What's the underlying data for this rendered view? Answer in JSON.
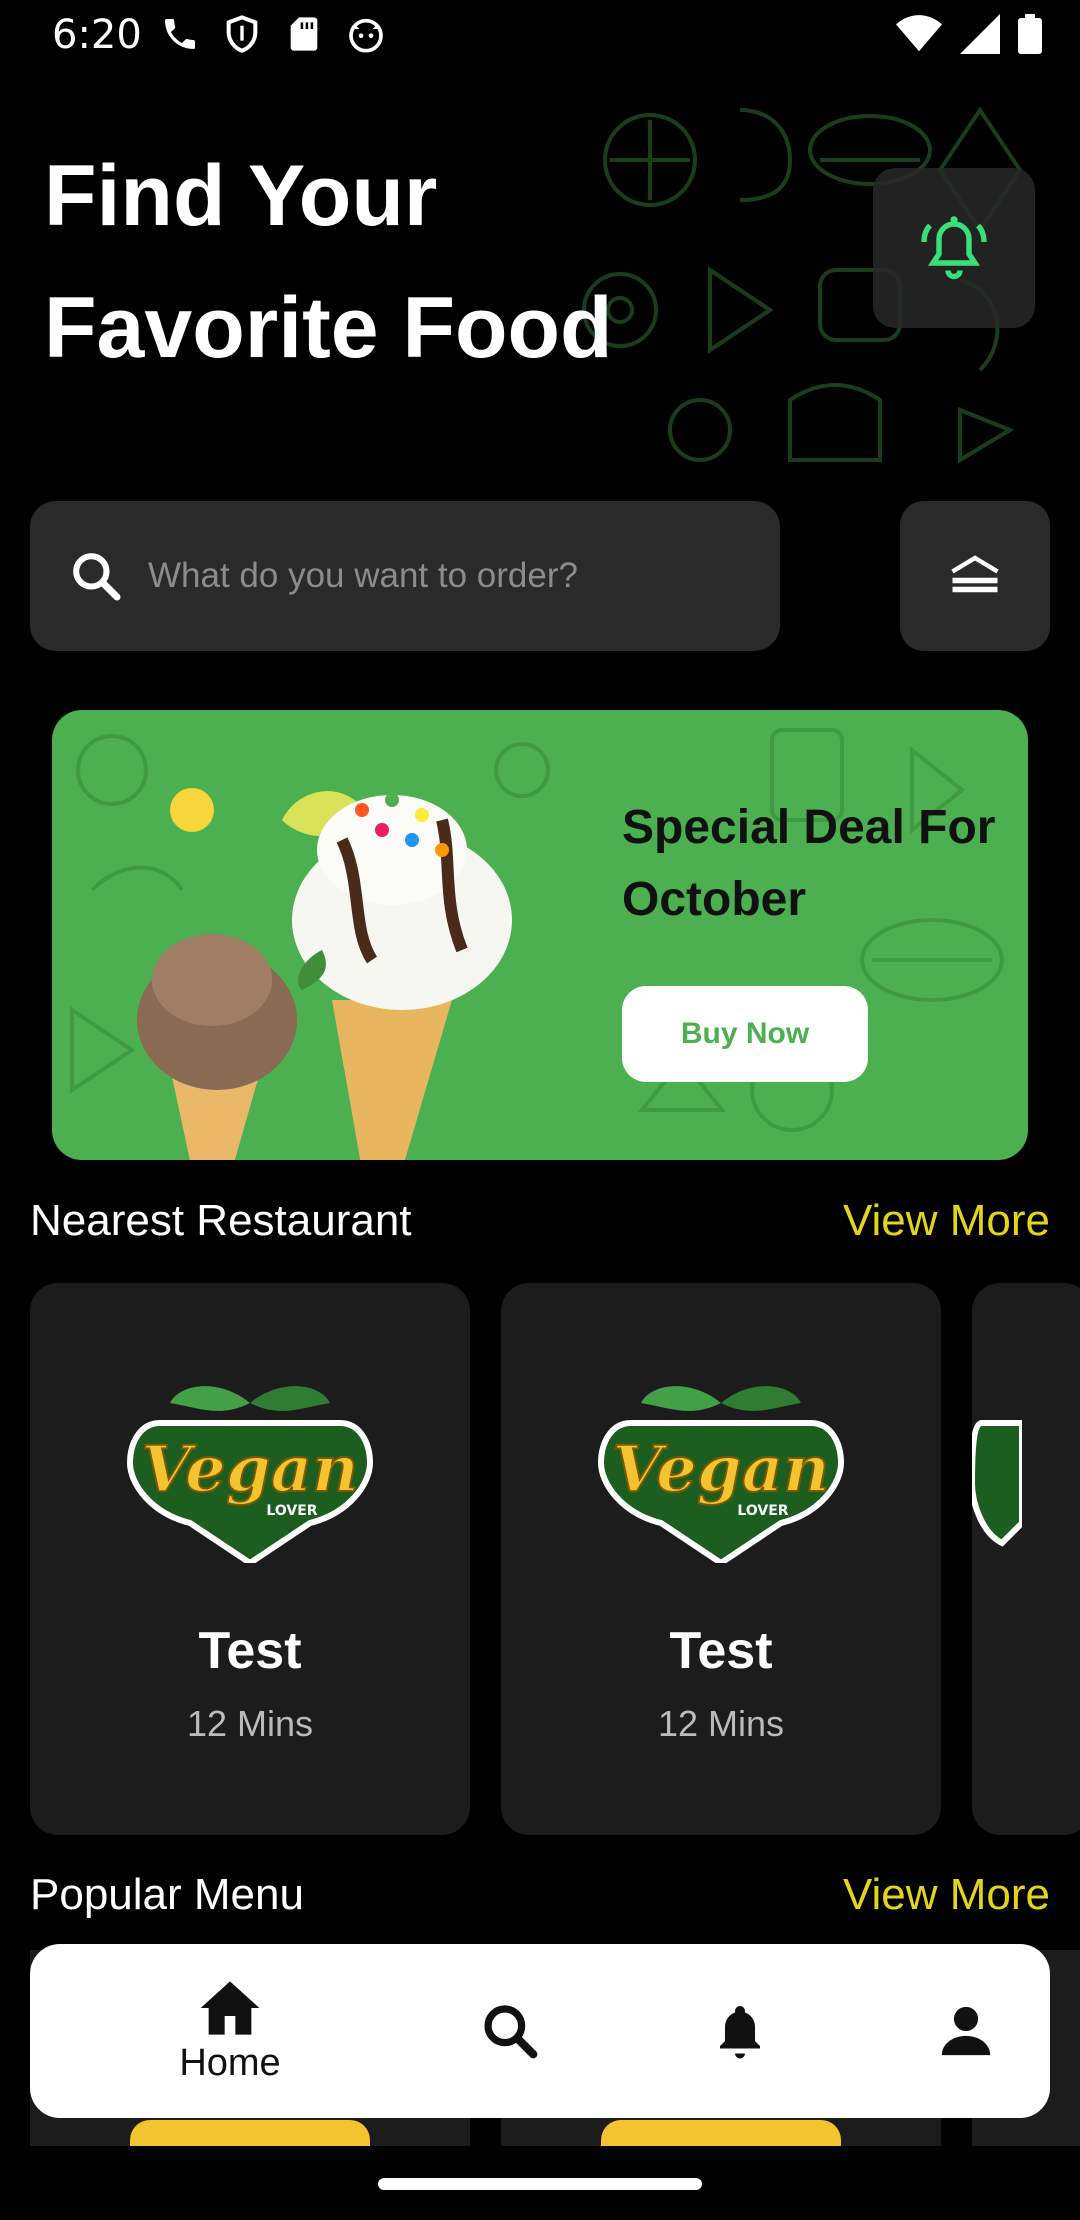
{
  "status_bar": {
    "time": "6:20"
  },
  "header": {
    "title": "Find Your Favorite Food"
  },
  "search": {
    "placeholder": "What do you want to order?"
  },
  "promo": {
    "title": "Special Deal For October",
    "button_label": "Buy Now"
  },
  "sections": {
    "nearest": {
      "title": "Nearest Restaurant",
      "view_more": "View More"
    },
    "popular": {
      "title": "Popular Menu",
      "view_more": "View More"
    }
  },
  "restaurants": [
    {
      "name": "Test",
      "time": "12 Mins",
      "logo_text": "Vegan",
      "logo_sub": "LOVER"
    },
    {
      "name": "Test",
      "time": "12 Mins",
      "logo_text": "Vegan",
      "logo_sub": "LOVER"
    }
  ],
  "bottom_nav": {
    "home": "Home"
  },
  "colors": {
    "accent": "#4caf50",
    "link": "#e3d51a",
    "card": "#1c1c1c"
  }
}
